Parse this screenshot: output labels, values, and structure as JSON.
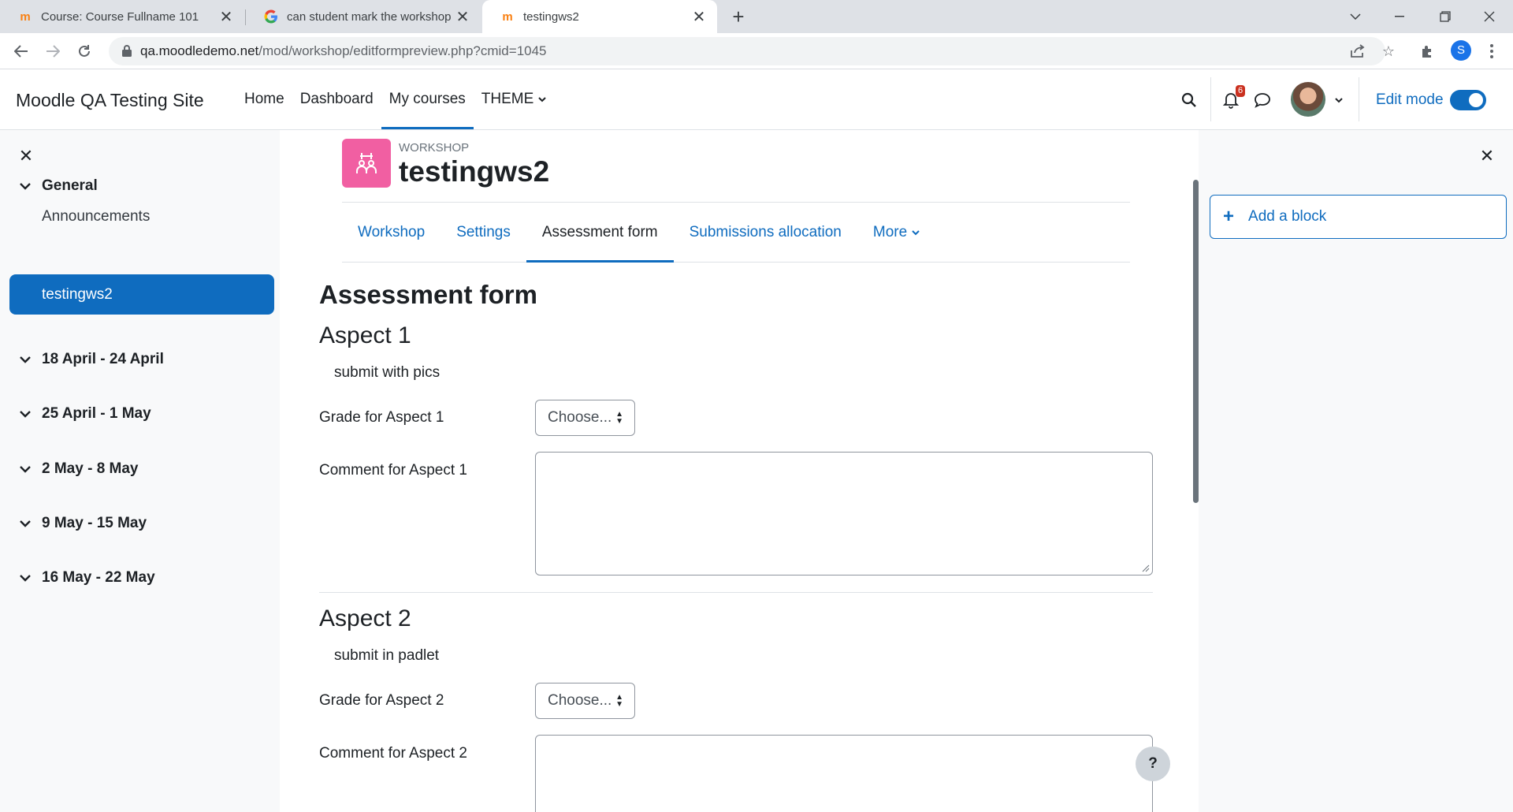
{
  "browser": {
    "tabs": [
      {
        "title": "Course: Course Fullname 101",
        "icon": "moodle-favicon"
      },
      {
        "title": "can student mark the workshop a",
        "icon": "google-favicon"
      },
      {
        "title": "testingws2",
        "icon": "moodle-favicon"
      }
    ],
    "new_tab_label": "+",
    "url_domain": "qa.moodledemo.net",
    "url_path": "/mod/workshop/editformpreview.php?cmid=1045",
    "profile_initial": "S"
  },
  "navbar": {
    "site_name": "Moodle QA Testing Site",
    "items": [
      "Home",
      "Dashboard",
      "My courses",
      "THEME"
    ],
    "notification_count": "6",
    "edit_mode_label": "Edit mode"
  },
  "course_index": {
    "general": "General",
    "items": [
      "Announcements",
      "testingws2"
    ],
    "sections": [
      "18 April - 24 April",
      "25 April - 1 May",
      "2 May - 8 May",
      "9 May - 15 May",
      "16 May - 22 May"
    ]
  },
  "activity": {
    "type_label": "WORKSHOP",
    "title": "testingws2",
    "icon_color": "#f15fa2"
  },
  "secondary_nav": [
    "Workshop",
    "Settings",
    "Assessment form",
    "Submissions allocation",
    "More"
  ],
  "form": {
    "heading": "Assessment form",
    "aspects": [
      {
        "title": "Aspect 1",
        "description": "submit with pics",
        "grade_label": "Grade for Aspect 1",
        "grade_value": "Choose...",
        "comment_label": "Comment for Aspect 1"
      },
      {
        "title": "Aspect 2",
        "description": "submit in padlet",
        "grade_label": "Grade for Aspect 2",
        "grade_value": "Choose...",
        "comment_label": "Comment for Aspect 2"
      }
    ]
  },
  "help_label": "?",
  "blocks": {
    "add_block_label": "Add a block"
  },
  "colors": {
    "primary": "#0f6cbf",
    "activity_workshop": "#f15fa2"
  }
}
